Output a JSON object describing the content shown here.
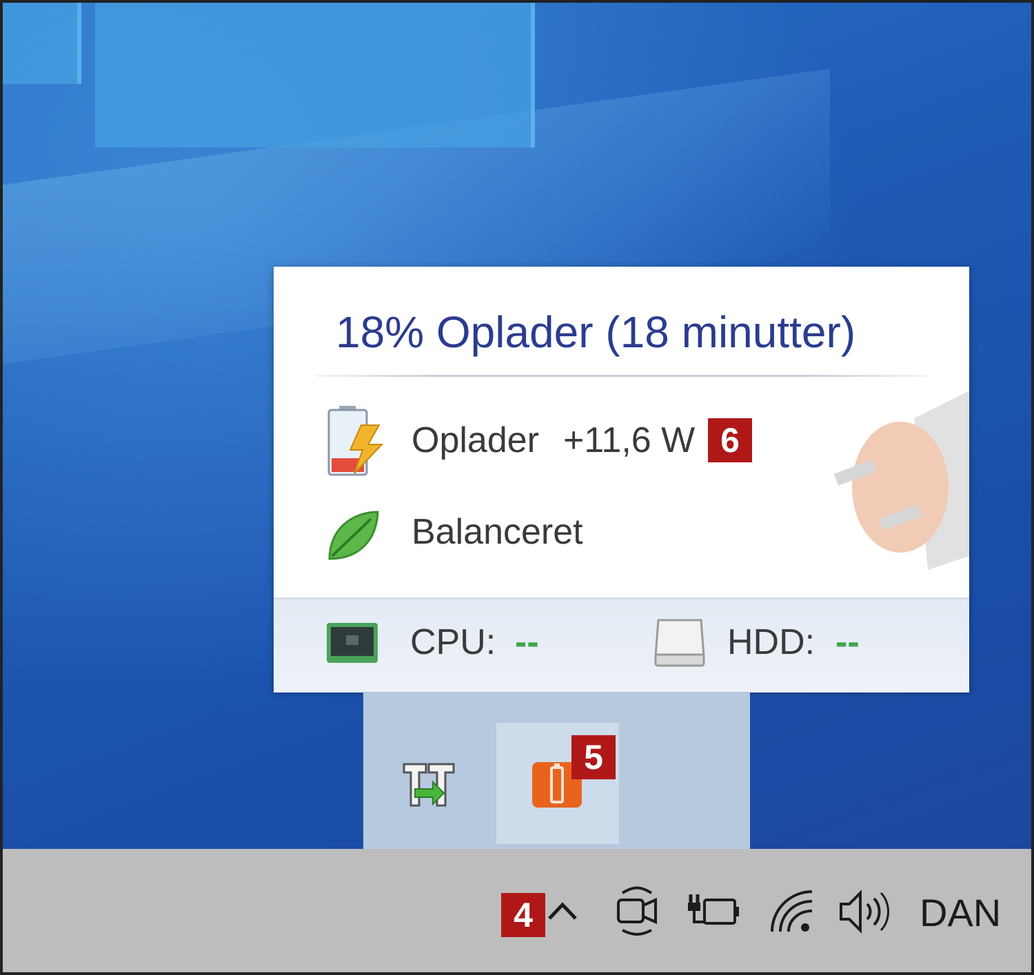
{
  "flyout": {
    "title": "18% Oplader (18 minutter)",
    "power_label": "Oplader",
    "power_value": "+11,6 W",
    "power_icon": "battery-charging-icon",
    "plan_label": "Balanceret",
    "plan_icon": "leaf-icon",
    "cpu_label": "CPU:",
    "cpu_value": "--",
    "cpu_icon": "cpu-chip-icon",
    "hdd_label": "HDD:",
    "hdd_value": "--",
    "hdd_icon": "hard-drive-icon"
  },
  "badges": {
    "four": "4",
    "five": "5",
    "six": "6"
  },
  "tray_overflow": {
    "icons": [
      "sync-transfer-icon",
      "battery-app-icon"
    ]
  },
  "taskbar": {
    "chevron_icon": "chevron-up-icon",
    "icons": [
      "meet-now-camera-icon",
      "power-battery-icon",
      "wifi-icon",
      "volume-icon"
    ],
    "language": "DAN"
  },
  "colors": {
    "title": "#2b3c8f",
    "badge": "#b01818",
    "stat_value": "#3fa64a",
    "battery_app": "#e8641e",
    "taskbar": "#bdbdbd"
  }
}
